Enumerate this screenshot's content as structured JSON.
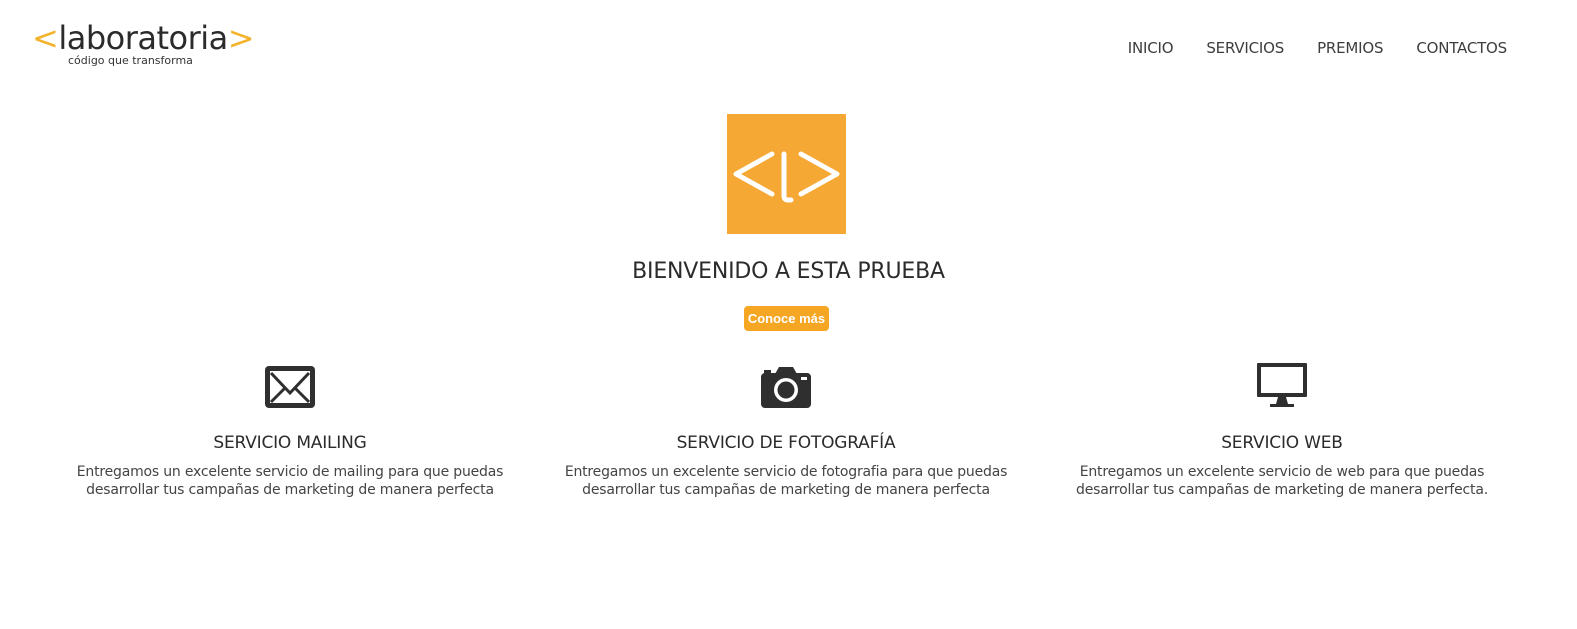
{
  "brand": {
    "bracket_open": "<",
    "name": "laboratoria",
    "bracket_close": ">",
    "tagline": "código que transforma",
    "accent_color": "#f5a623"
  },
  "nav": {
    "items": [
      {
        "label": "INICIO"
      },
      {
        "label": "SERVICIOS"
      },
      {
        "label": "PREMIOS"
      },
      {
        "label": "CONTACTOS"
      }
    ]
  },
  "hero": {
    "logo_icon": "laboratoria-symbol-icon",
    "title": "BIENVENIDO A ESTA PRUEBA",
    "cta_label": "Conoce más"
  },
  "services": [
    {
      "icon": "envelope-icon",
      "title": "SERVICIO MAILING",
      "desc_line1": "Entregamos un excelente servicio de mailing para que puedas",
      "desc_line2": "desarrollar tus campañas de marketing de manera perfecta"
    },
    {
      "icon": "camera-icon",
      "title": "SERVICIO DE FOTOGRAFÍA",
      "desc_line1": "Entregamos un excelente servicio de fotografia para que puedas",
      "desc_line2": "desarrollar tus campañas de marketing de manera perfecta"
    },
    {
      "icon": "monitor-icon",
      "title": "SERVICIO WEB",
      "desc_line1": "Entregamos un excelente servicio de web para que puedas",
      "desc_line2": "desarrollar tus campañas de marketing de manera perfecta."
    }
  ]
}
